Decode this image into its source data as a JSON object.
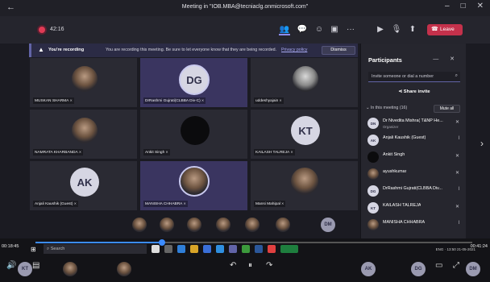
{
  "window": {
    "title": "Meeting in \"IOB.MBA@tecniaclg.onmicrosoft.com\"",
    "controls": [
      "–",
      "□",
      "✕"
    ],
    "back": "←"
  },
  "toolbar": {
    "timer": "42:16",
    "leave_label": "Leave",
    "more": "···"
  },
  "banner": {
    "bold": "You're recording",
    "text": "You are recording this meeting. Be sure to let everyone know that they are being recorded.",
    "link": "Privacy policy",
    "dismiss": "Dismiss"
  },
  "tiles": [
    {
      "name": "MUSKAN SHARMA",
      "type": "photo"
    },
    {
      "name": "DrRashmi Gujrati(CLBBA Div-C)",
      "type": "initials",
      "initials": "DG"
    },
    {
      "name": "uddeshyajain",
      "type": "photo"
    },
    {
      "name": "NAMRATA KHARBANDA",
      "type": "photo"
    },
    {
      "name": "Ankit Singh",
      "type": "dark"
    },
    {
      "name": "KAILASH TALREJA",
      "type": "initials",
      "initials": "KT"
    },
    {
      "name": "Anjali Kaushik (Guest)",
      "type": "initials",
      "initials": "AK"
    },
    {
      "name": "MANISHA CHHABRA",
      "type": "photo"
    },
    {
      "name": "Mansi Mahipal",
      "type": "photo"
    }
  ],
  "strip": {
    "last_initials": "DM"
  },
  "participants": {
    "title": "Participants",
    "search_placeholder": "Invite someone or dial a number",
    "share_label": "Share invite",
    "section_label": "In this meeting (16)",
    "mute_all": "Mute all",
    "list": [
      {
        "name": "Dr Nivedita Mishra( T&NP He...",
        "role": "Organizer",
        "initials": "DN"
      },
      {
        "name": "Anjali Kaushik (Guest)",
        "initials": "AK"
      },
      {
        "name": "Ankit Singh",
        "initials": ""
      },
      {
        "name": "ayushkumar",
        "initials": ""
      },
      {
        "name": "DrRashmi Gujrati(CLBBA Div...",
        "initials": "DG"
      },
      {
        "name": "KAILASH TALREJA",
        "initials": "KT"
      },
      {
        "name": "MANISHA CHHABRA",
        "initials": ""
      }
    ]
  },
  "media": {
    "time_current": "00:18:45",
    "time_total": "00:41:24",
    "progress": 0.29,
    "search_label": "Search",
    "tray_time": "13:50",
    "tray_date": "21-05-2021",
    "tray_lang": "ENG",
    "bottom_initials": [
      "KT",
      "AK",
      "DG",
      "DM"
    ]
  }
}
